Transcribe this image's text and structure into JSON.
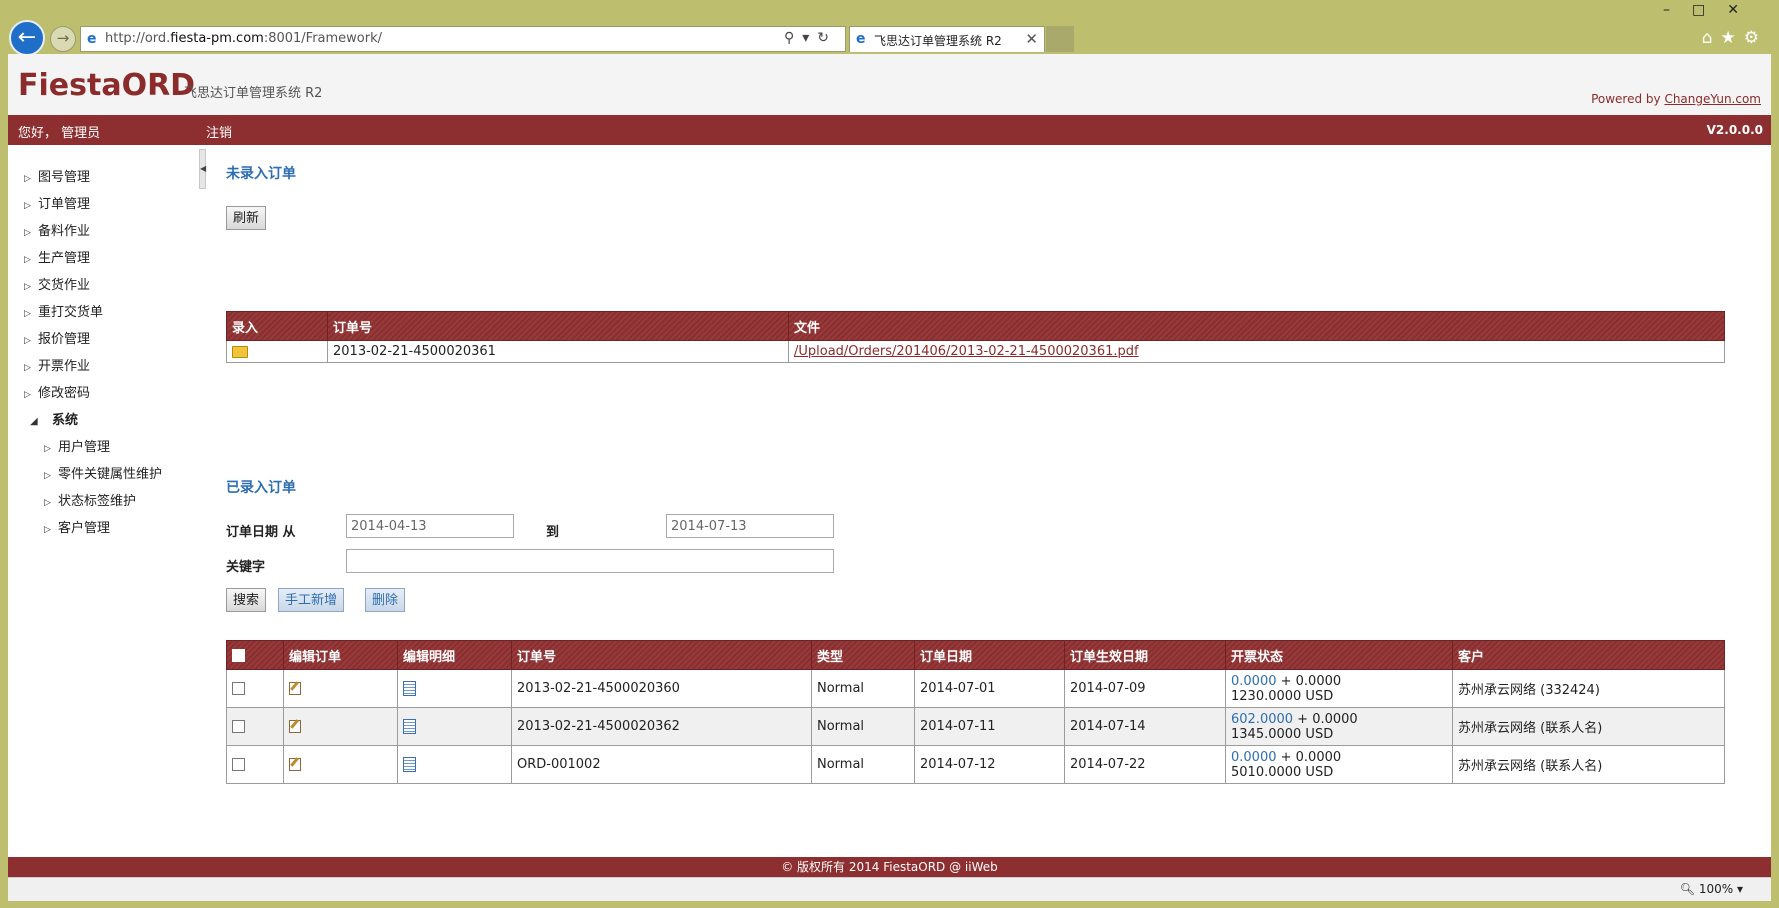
{
  "browser": {
    "url_prefix": "http://ord.",
    "url_domain": "fiesta-pm.com",
    "url_suffix": ":8001/Framework/",
    "tab_title": "飞思达订单管理系统 R2",
    "tab_close": "✕",
    "zoom": "100%"
  },
  "brand": {
    "logo": "FiestaORD",
    "subtitle": "飞思达订单管理系统 R2",
    "powered_prefix": "Powered by ",
    "powered_link": "ChangeYun.com"
  },
  "topbar": {
    "greeting": "您好， 管理员",
    "logout": "注销",
    "version": "V2.0.0.0"
  },
  "sidebar": {
    "items": [
      "图号管理",
      "订单管理",
      "备料作业",
      "生产管理",
      "交货作业",
      "重打交货单",
      "报价管理",
      "开票作业",
      "修改密码"
    ],
    "system_label": "系统",
    "system_items": [
      "用户管理",
      "零件关键属性维护",
      "状态标签维护",
      "客户管理"
    ]
  },
  "unentered": {
    "title": "未录入订单",
    "refresh": "刷新",
    "columns": [
      "录入",
      "订单号",
      "文件"
    ],
    "rows": [
      {
        "order_no": "2013-02-21-4500020361",
        "file": "/Upload/Orders/201406/2013-02-21-4500020361.pdf"
      }
    ]
  },
  "entered": {
    "title": "已录入订单",
    "date_from_label": "订单日期 从",
    "date_from": "2014-04-13",
    "date_to_label": "到",
    "date_to": "2014-07-13",
    "keyword_label": "关键字",
    "keyword": "",
    "search": "搜索",
    "add_manual": "手工新增",
    "delete": "删除",
    "columns": [
      "编辑订单",
      "编辑明细",
      "订单号",
      "类型",
      "订单日期",
      "订单生效日期",
      "开票状态",
      "客户"
    ],
    "rows": [
      {
        "order_no": "2013-02-21-4500020360",
        "type": "Normal",
        "order_date": "2014-07-01",
        "effective_date": "2014-07-09",
        "invoiced": "0.0000",
        "plus": " + 0.0000",
        "total": "1230.0000 USD",
        "customer": "苏州承云网络 (332424)"
      },
      {
        "order_no": "2013-02-21-4500020362",
        "type": "Normal",
        "order_date": "2014-07-11",
        "effective_date": "2014-07-14",
        "invoiced": "602.0000",
        "plus": " + 0.0000",
        "total": "1345.0000 USD",
        "customer": "苏州承云网络 (联系人名)"
      },
      {
        "order_no": "ORD-001002",
        "type": "Normal",
        "order_date": "2014-07-12",
        "effective_date": "2014-07-22",
        "invoiced": "0.0000",
        "plus": " + 0.0000",
        "total": "5010.0000 USD",
        "customer": "苏州承云网络 (联系人名)"
      }
    ]
  },
  "footer": "© 版权所有 2014 FiestaORD @ iiWeb"
}
